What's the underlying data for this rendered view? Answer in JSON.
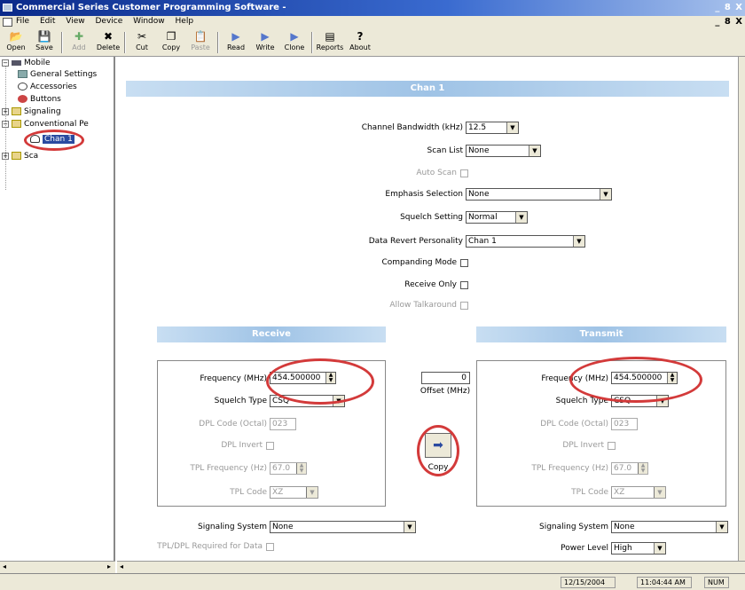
{
  "window": {
    "title": "Commercial Series Customer Programming Software -",
    "controls": "_ 8 X"
  },
  "menu": [
    "File",
    "Edit",
    "View",
    "Device",
    "Window",
    "Help"
  ],
  "toolbar": [
    {
      "label": "Open",
      "icon": "open-folder-icon",
      "glyph": "📂",
      "enabled": true
    },
    {
      "label": "Save",
      "icon": "save-disk-icon",
      "glyph": "💾",
      "enabled": true
    },
    {
      "label": "Add",
      "icon": "add-icon",
      "glyph": "✚",
      "enabled": false
    },
    {
      "label": "Delete",
      "icon": "delete-x-icon",
      "glyph": "✖",
      "enabled": true
    },
    {
      "label": "Cut",
      "icon": "scissors-icon",
      "glyph": "✂",
      "enabled": true
    },
    {
      "label": "Copy",
      "icon": "copy-icon",
      "glyph": "❐",
      "enabled": true
    },
    {
      "label": "Paste",
      "icon": "paste-icon",
      "glyph": "📋",
      "enabled": false
    },
    {
      "label": "Read",
      "icon": "read-radio-icon",
      "glyph": "▶",
      "enabled": true
    },
    {
      "label": "Write",
      "icon": "write-radio-icon",
      "glyph": "▶",
      "enabled": true
    },
    {
      "label": "Clone",
      "icon": "clone-radio-icon",
      "glyph": "▶",
      "enabled": true
    },
    {
      "label": "Reports",
      "icon": "report-icon",
      "glyph": "▤",
      "enabled": true
    },
    {
      "label": "About",
      "icon": "question-mark-icon",
      "glyph": "?",
      "enabled": true
    }
  ],
  "tree": {
    "items": [
      {
        "label": "Mobile",
        "icon": "radio-device-icon"
      },
      {
        "label": "General Settings",
        "icon": "settings-icon"
      },
      {
        "label": "Accessories",
        "icon": "accessory-icon"
      },
      {
        "label": "Buttons",
        "icon": "buttons-icon"
      },
      {
        "label": "Signaling",
        "icon": "folder-icon"
      },
      {
        "label": "Conventional Pe",
        "icon": "folder-icon"
      },
      {
        "label": "Chan 1",
        "icon": "person-channel-icon"
      },
      {
        "label": "Sca",
        "icon": "folder-icon"
      }
    ]
  },
  "form": {
    "title": "Chan 1",
    "channel_bandwidth": {
      "label": "Channel Bandwidth (kHz)",
      "value": "12.5"
    },
    "scan_list": {
      "label": "Scan List",
      "value": "None"
    },
    "auto_scan": {
      "label": "Auto Scan"
    },
    "emphasis_selection": {
      "label": "Emphasis Selection",
      "value": "None"
    },
    "squelch_setting": {
      "label": "Squelch Setting",
      "value": "Normal"
    },
    "data_revert": {
      "label": "Data Revert Personality",
      "value": "Chan 1"
    },
    "companding_mode": {
      "label": "Companding Mode"
    },
    "receive_only": {
      "label": "Receive Only"
    },
    "allow_talkaround": {
      "label": "Allow Talkaround"
    }
  },
  "receive": {
    "header": "Receive",
    "frequency": {
      "label": "Frequency (MHz)",
      "value": "454.500000"
    },
    "squelch_type": {
      "label": "Squelch Type",
      "value": "CSQ"
    },
    "dpl_code": {
      "label": "DPL Code (Octal)",
      "value": "023"
    },
    "dpl_invert": {
      "label": "DPL Invert"
    },
    "tpl_frequency": {
      "label": "TPL Frequency (Hz)",
      "value": "67.0"
    },
    "tpl_code": {
      "label": "TPL Code",
      "value": "XZ"
    },
    "signaling_system": {
      "label": "Signaling System",
      "value": "None"
    },
    "tpl_dpl_required": {
      "label": "TPL/DPL Required for Data"
    }
  },
  "offset": {
    "value": "0",
    "label": "Offset (MHz)",
    "copy_label": "Copy"
  },
  "transmit": {
    "header": "Transmit",
    "frequency": {
      "label": "Frequency (MHz)",
      "value": "454.500000"
    },
    "squelch_type": {
      "label": "Squelch Type",
      "value": "CSQ"
    },
    "dpl_code": {
      "label": "DPL Code (Octal)",
      "value": "023"
    },
    "dpl_invert": {
      "label": "DPL Invert"
    },
    "tpl_frequency": {
      "label": "TPL Frequency (Hz)",
      "value": "67.0"
    },
    "tpl_code": {
      "label": "TPL Code",
      "value": "XZ"
    },
    "signaling_system": {
      "label": "Signaling System",
      "value": "None"
    },
    "power_level": {
      "label": "Power Level",
      "value": "High"
    }
  },
  "status": {
    "date": "12/15/2004",
    "time": "11:04:44 AM",
    "num": "NUM"
  },
  "colors": {
    "highlight_circle": "#d33a3a",
    "header_blue": "#9fc3e6",
    "title_blue": "#0a2a8a"
  }
}
